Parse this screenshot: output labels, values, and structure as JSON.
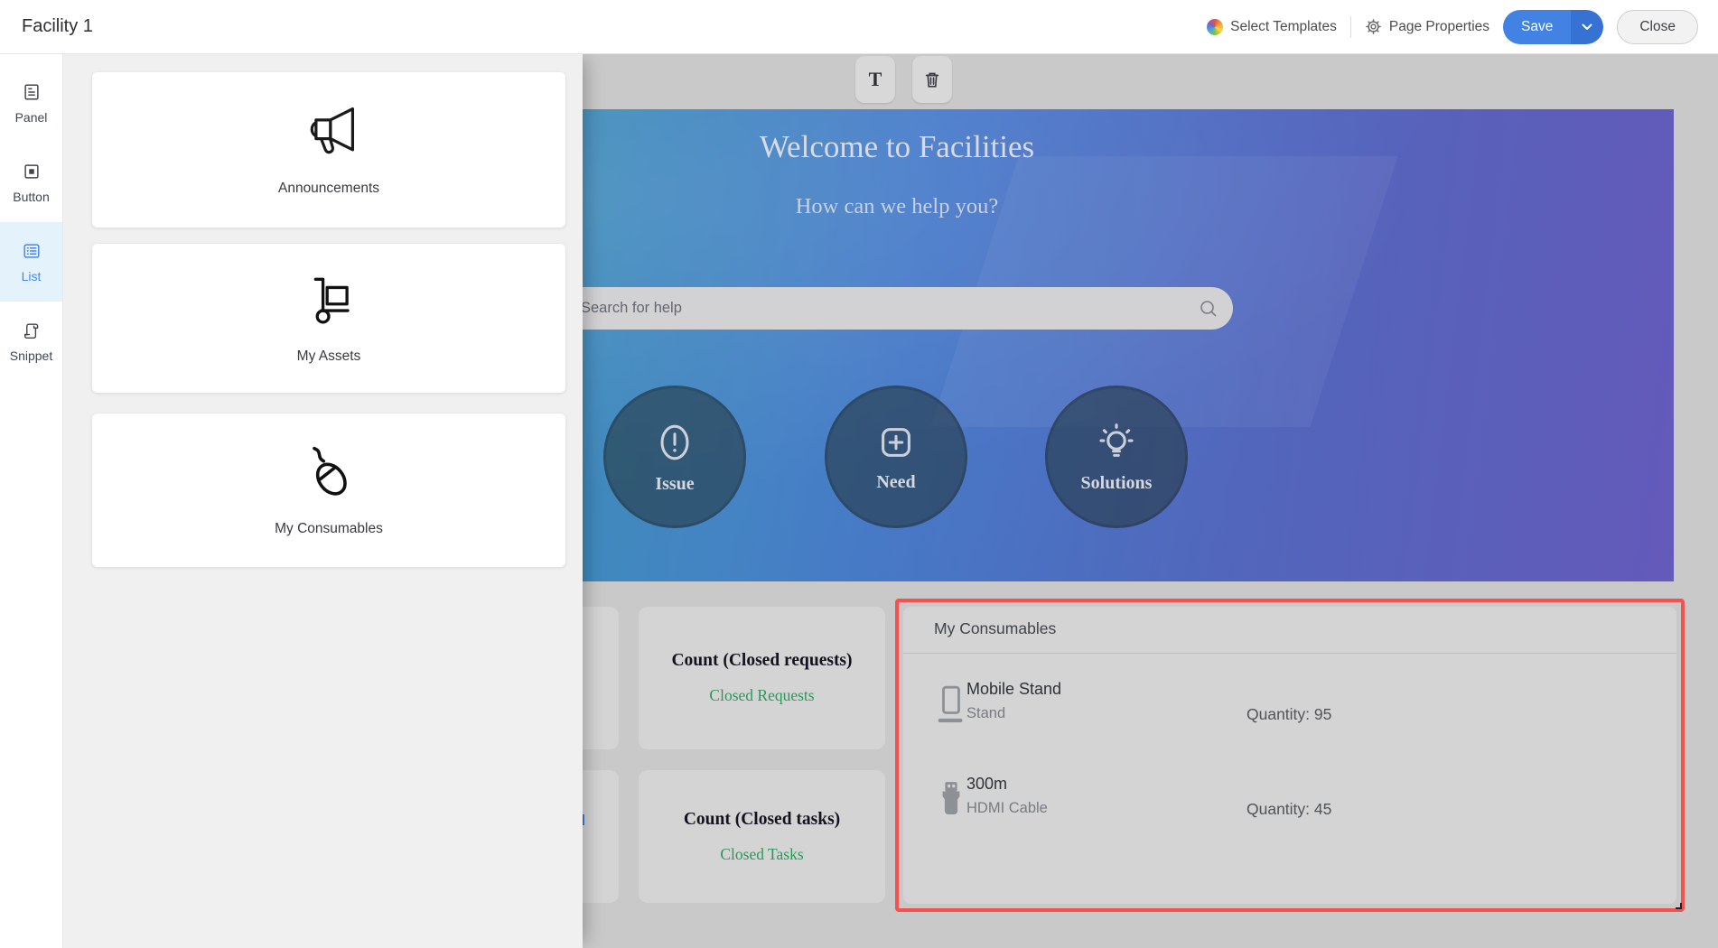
{
  "app": {
    "title": "Facility 1"
  },
  "header": {
    "select_templates": "Select Templates",
    "page_properties": "Page Properties",
    "save_label": "Save",
    "close_label": "Close"
  },
  "sidebar": {
    "items": [
      {
        "label": "Panel",
        "icon": "panel-icon",
        "selected": false
      },
      {
        "label": "Button",
        "icon": "button-icon",
        "selected": false
      },
      {
        "label": "List",
        "icon": "list-icon",
        "selected": true
      },
      {
        "label": "Snippet",
        "icon": "snippet-icon",
        "selected": false
      }
    ]
  },
  "widget_panel": {
    "cards": [
      {
        "label": "Announcements",
        "icon": "megaphone-icon"
      },
      {
        "label": "My Assets",
        "icon": "handtruck-icon"
      },
      {
        "label": "My Consumables",
        "icon": "mouse-icon"
      }
    ]
  },
  "canvas": {
    "text_tool_label": "T",
    "delete_tool_icon": "trash-icon",
    "banner": {
      "title": "Welcome to Facilities",
      "subtitle": "How can we help you?",
      "search_placeholder": "Search for help",
      "search_icon": "magnifier-icon",
      "actions": [
        {
          "label": "Issue",
          "icon": "alert-icon"
        },
        {
          "label": "Need",
          "icon": "plus-icon"
        },
        {
          "label": "Solutions",
          "icon": "bulb-icon"
        }
      ]
    },
    "stat_cards": [
      {
        "title": "Count (Closed requests)",
        "link": "Closed Requests"
      },
      {
        "title": "Count (Closed tasks)",
        "link": "Closed Tasks"
      }
    ],
    "consumables": {
      "title": "My Consumables",
      "items": [
        {
          "name": "Mobile Stand",
          "category": "Stand",
          "quantity": "Quantity: 95",
          "icon": "mobile-stand-icon"
        },
        {
          "name": "300m",
          "category": "HDMI Cable",
          "quantity": "Quantity: 45",
          "icon": "hdmi-plug-icon"
        }
      ]
    }
  },
  "colors": {
    "accent_blue": "#4182e2",
    "selection_red": "#f4514f",
    "link_green": "#27995a",
    "banner_teal": "#2f9fa6",
    "banner_purple": "#6f63cc",
    "sidebar_selected_bg": "#e4f2fc"
  }
}
